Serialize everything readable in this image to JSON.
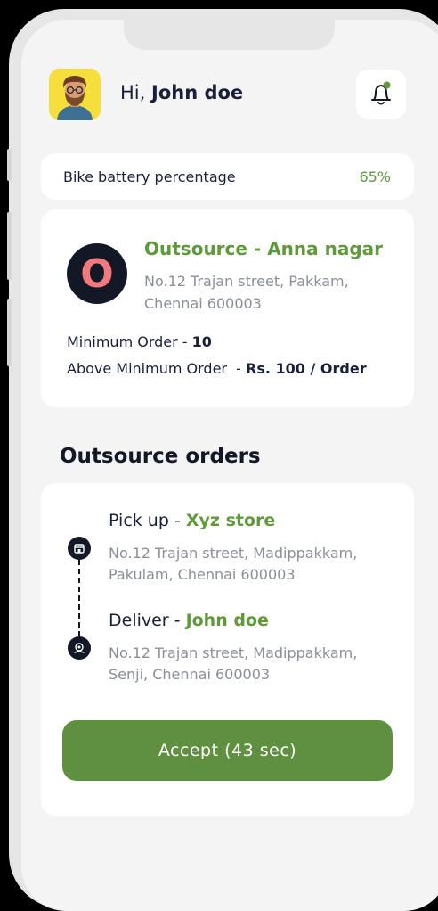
{
  "header": {
    "greeting_prefix": "Hi,",
    "user_name": "John doe",
    "bell_icon": "bell-icon",
    "notification_dot_color": "#5f9a3a"
  },
  "battery": {
    "label": "Bike battery percentage",
    "value": "65%"
  },
  "outsource": {
    "logo_letter": "O",
    "title": "Outsource - Anna nagar",
    "address": "No.12 Trajan street, Pakkam, Chennai 600003",
    "min_order_label": "Minimum Order - ",
    "min_order_value": "10",
    "above_min_label": "Above Minimum Order  - ",
    "above_min_value": "Rs. 100 / Order"
  },
  "orders": {
    "section_title": "Outsource orders",
    "pickup": {
      "label": "Pick up - ",
      "name": "Xyz store",
      "address": "No.12 Trajan street, Madippakkam, Pakulam, Chennai 600003",
      "icon": "store-icon"
    },
    "deliver": {
      "label": "Deliver - ",
      "name": "John doe",
      "address": "No.12 Trajan street, Madippakkam, Senji, Chennai 600003",
      "icon": "location-pin-icon"
    },
    "accept_label": "Accept (43 sec)"
  },
  "colors": {
    "accent_green": "#5f9a3a",
    "button_green": "#5f9040",
    "dark_navy": "#121826",
    "avatar_bg": "#f7df3b"
  }
}
